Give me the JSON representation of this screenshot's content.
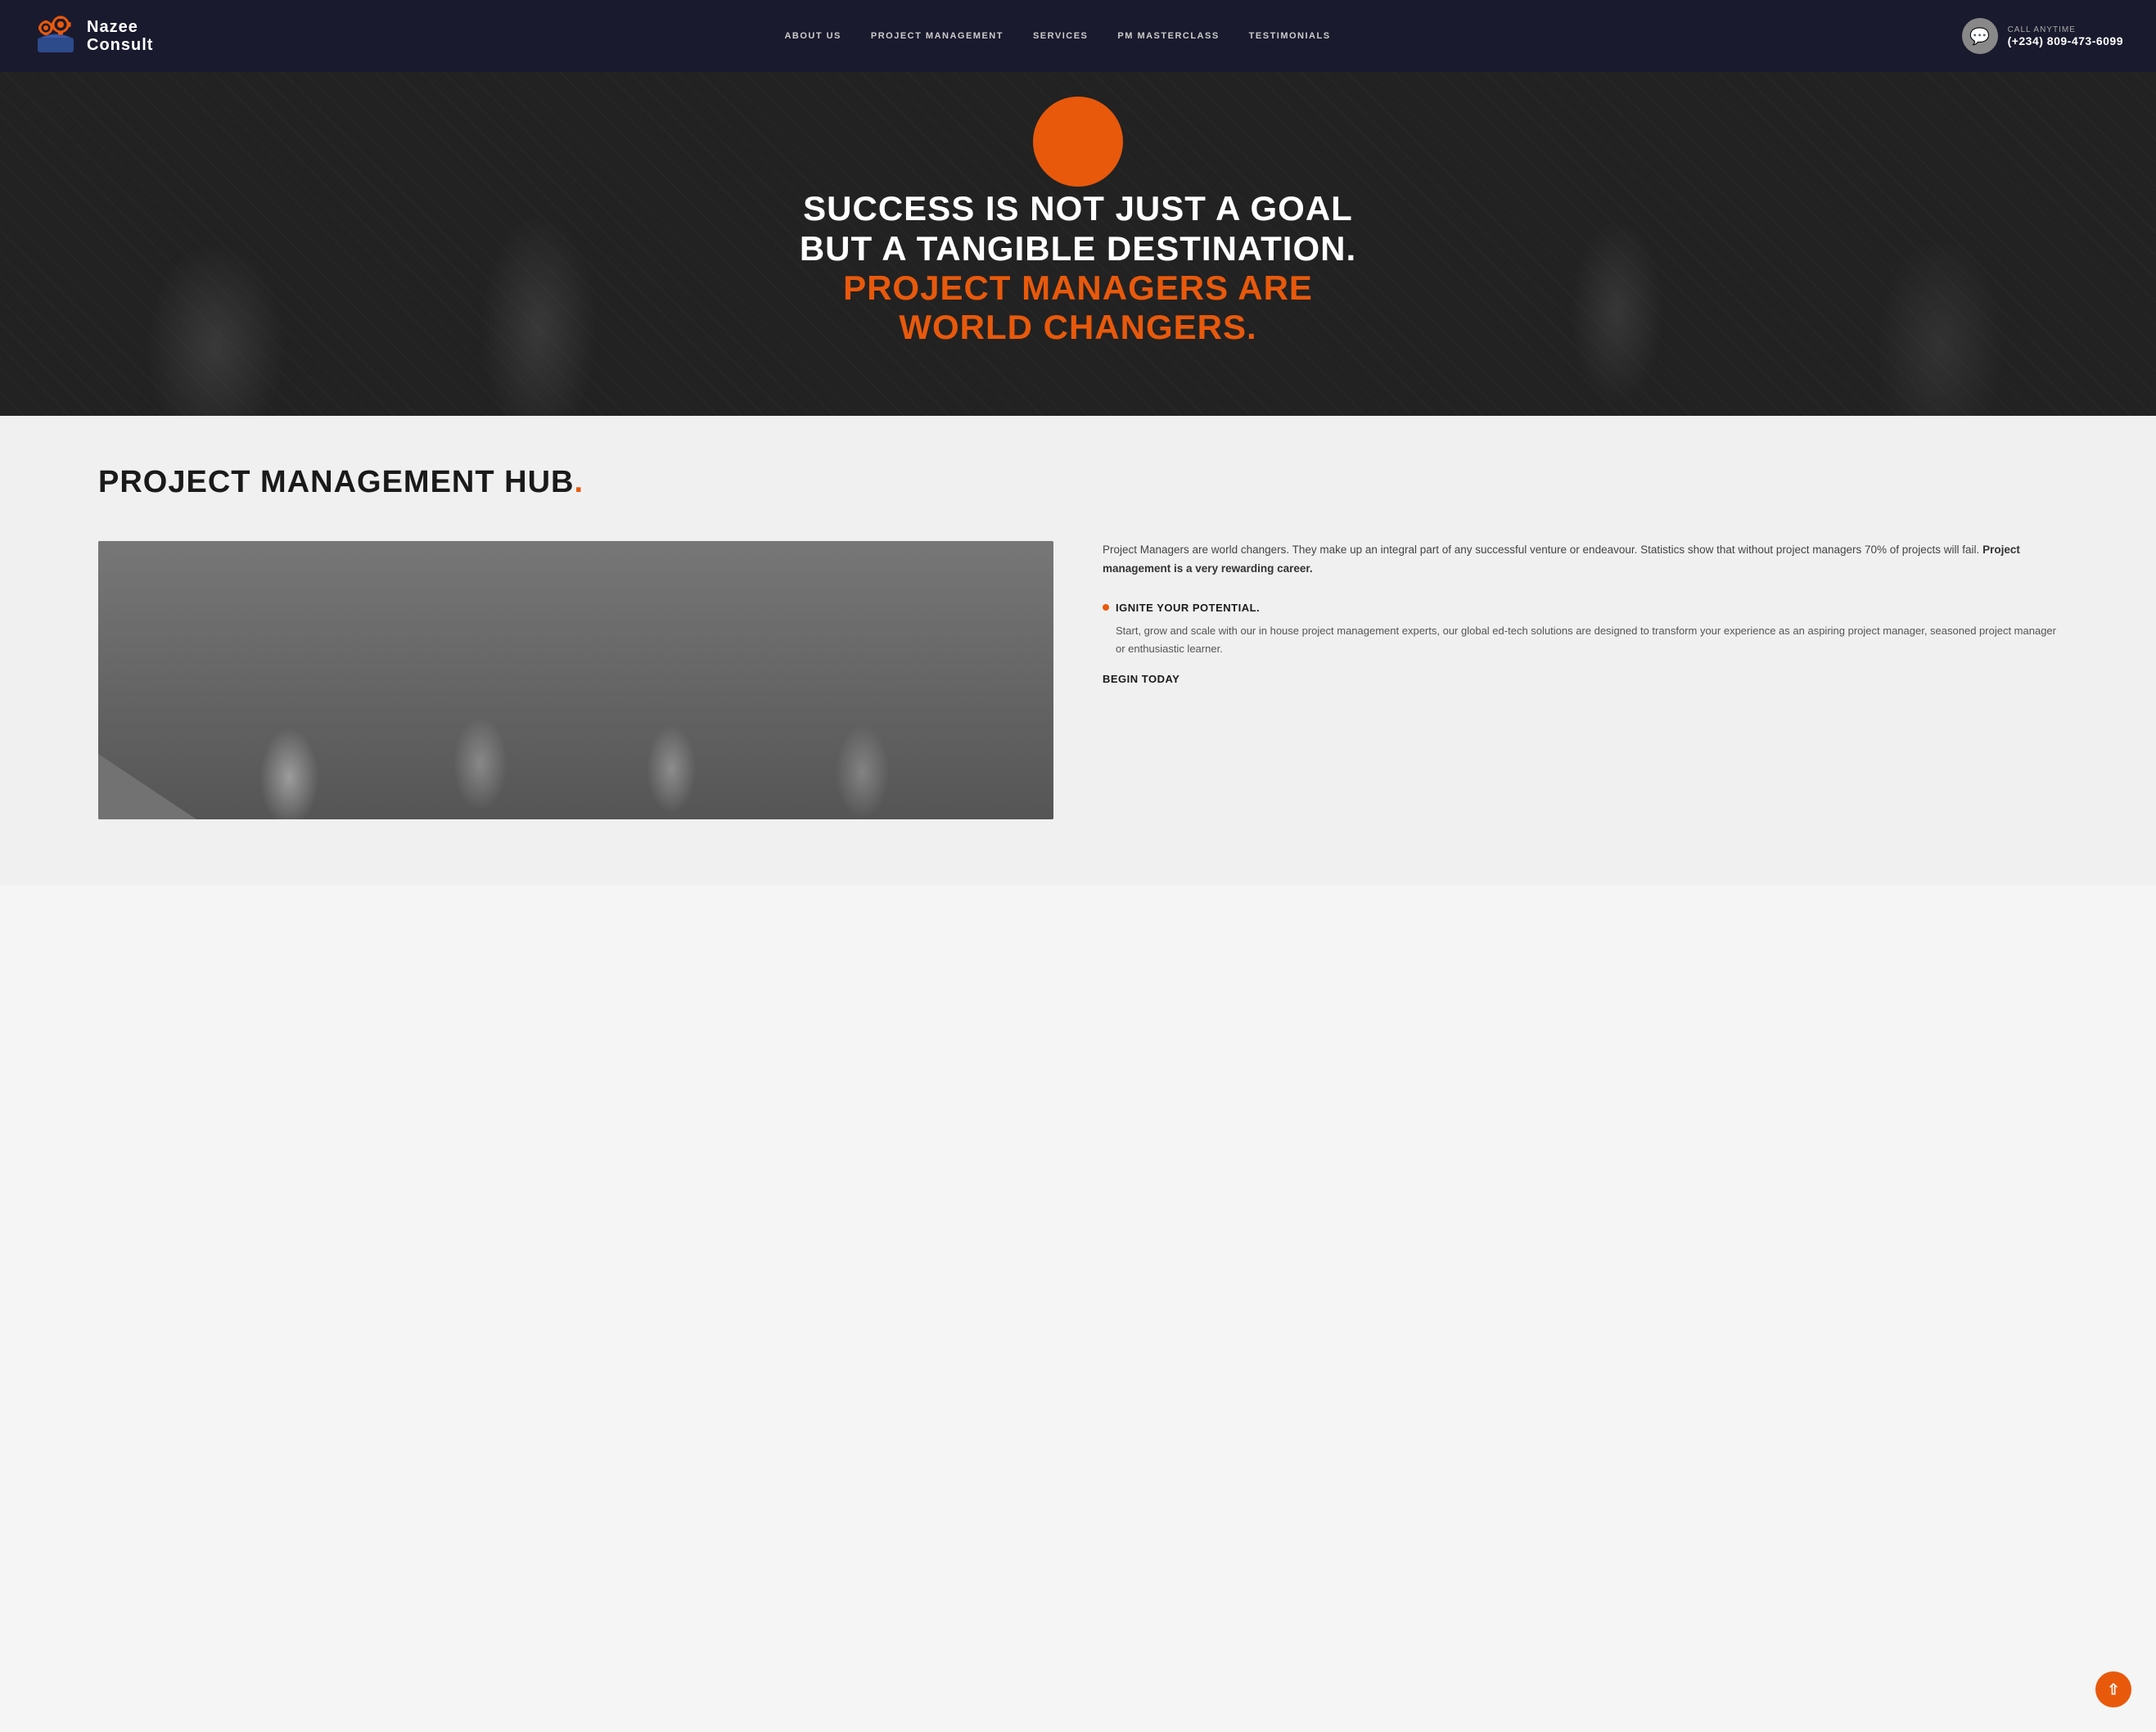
{
  "header": {
    "logo_name": "Nazee",
    "logo_consult": "Consult",
    "nav_items": [
      {
        "label": "ABOUT US",
        "id": "about-us"
      },
      {
        "label": "PROJECT MANAGEMENT",
        "id": "project-management"
      },
      {
        "label": "SERVICES",
        "id": "services"
      },
      {
        "label": "PM MASTERCLASS",
        "id": "pm-masterclass"
      },
      {
        "label": "TESTIMONIALS",
        "id": "testimonials"
      }
    ],
    "call_anytime": "CALL ANYTIME",
    "phone": "(+234) 809-473-6099"
  },
  "hero": {
    "headline_white": "SUCCESS IS NOT JUST A GOAL BUT A TANGIBLE DESTINATION.",
    "headline_orange": "PROJECT MANAGERS ARE WORLD CHANGERS."
  },
  "main": {
    "section_title": "PROJECT MANAGEMENT HUB",
    "section_title_dot": ".",
    "intro_text_plain": "Project Managers are world changers. They make up an integral part of any successful venture or endeavour. Statistics show that without project managers 70% of projects will fail.",
    "intro_text_bold": "Project management is a very rewarding career.",
    "bullet1_title": "IGNITE YOUR POTENTIAL.",
    "bullet1_desc": "Start, grow and scale with our in house project management experts, our global ed-tech solutions are designed to transform your experience as an aspiring project manager, seasoned project manager or enthusiastic learner.",
    "begin_today": "BEGIN TODAY"
  },
  "scroll_top_label": "^"
}
